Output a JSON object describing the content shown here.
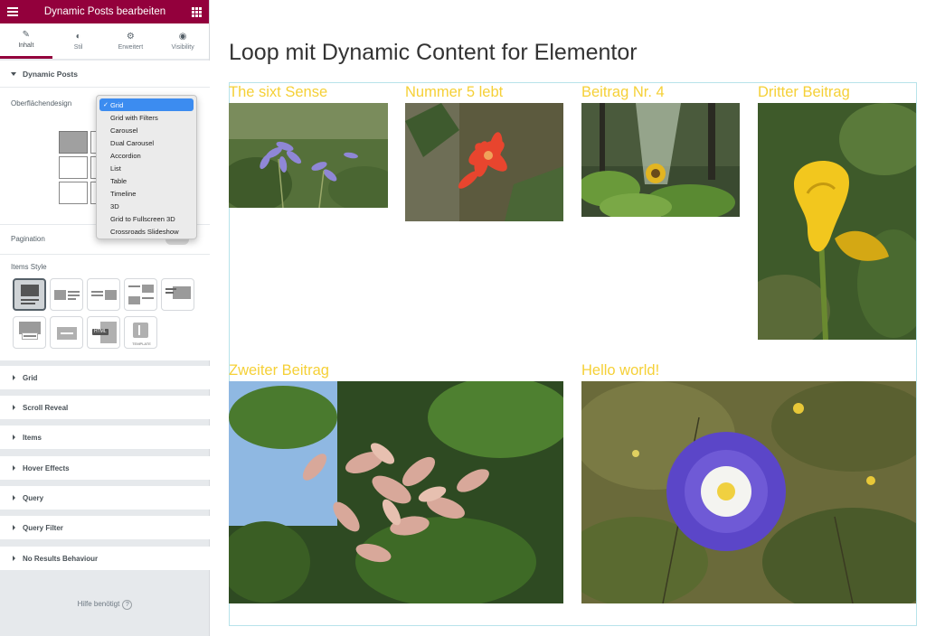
{
  "editor": {
    "title": "Dynamic Posts bearbeiten",
    "tabs": [
      {
        "label": "Inhalt",
        "icon": "pencil-icon"
      },
      {
        "label": "Stil",
        "icon": "contrast-icon"
      },
      {
        "label": "Erweitert",
        "icon": "gear-icon"
      },
      {
        "label": "Visibility",
        "icon": "eye-icon"
      }
    ],
    "section_title": "Dynamic Posts",
    "skin_label": "Oberflächendesign",
    "pagination_label": "Pagination",
    "items_style_label": "Items Style",
    "html_badge": "HTML",
    "template_badge": "TEMPLATE",
    "collapsed_sections": [
      "Grid",
      "Scroll Reveal",
      "Items",
      "Hover Effects",
      "Query",
      "Query Filter",
      "No Results Behaviour"
    ],
    "help_text": "Hilfe benötigt",
    "dropdown": {
      "selected": "Grid",
      "options": [
        "Grid",
        "Grid with Filters",
        "Carousel",
        "Dual Carousel",
        "Accordion",
        "List",
        "Table",
        "Timeline",
        "3D",
        "Grid to Fullscreen 3D",
        "Crossroads Slideshow"
      ]
    },
    "colors": {
      "brand": "#93003c",
      "select_highlight": "#3c8cf0"
    }
  },
  "preview": {
    "page_title": "Loop mit Dynamic Content for Elementor",
    "title_color": "#f5d037",
    "posts": [
      {
        "title": "The sixt Sense",
        "image": "purple-agapanthus-flowers"
      },
      {
        "title": "Nummer 5 lebt",
        "image": "red-cactus-flower"
      },
      {
        "title": "Beitrag Nr. 4",
        "image": "sunflower-forest"
      },
      {
        "title": "Dritter Beitrag",
        "image": "yellow-calla-lily"
      },
      {
        "title": "Zweiter Beitrag",
        "image": "maple-seeds-branch"
      },
      {
        "title": "Hello world!",
        "image": "blue-morning-glory"
      }
    ]
  }
}
